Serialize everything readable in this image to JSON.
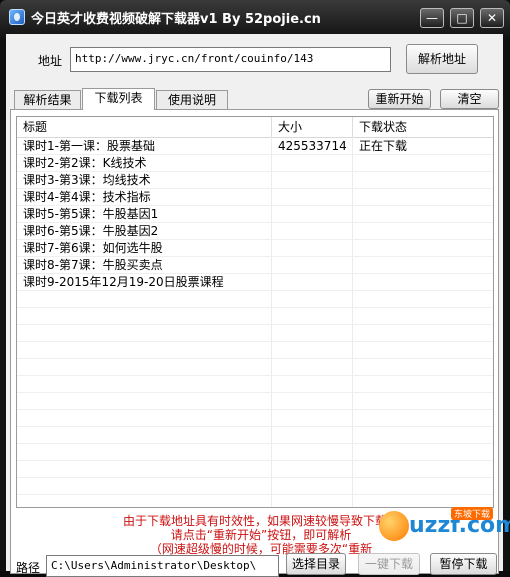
{
  "window": {
    "title": "今日英才收费视频破解下载器v1 By 52pojie.cn",
    "minimize_glyph": "—",
    "maximize_glyph": "□",
    "close_glyph": "✕"
  },
  "address": {
    "label": "地址",
    "value": "http://www.jryc.cn/front/couinfo/143",
    "parse_button": "解析地址"
  },
  "tabs": [
    {
      "label": "解析结果",
      "active": false
    },
    {
      "label": "下载列表",
      "active": true
    },
    {
      "label": "使用说明",
      "active": false
    }
  ],
  "toolbar": {
    "restart_button": "重新开始",
    "clear_button": "清空"
  },
  "table": {
    "columns": [
      "标题",
      "大小",
      "下载状态"
    ],
    "rows": [
      {
        "title": "课时1-第一课：股票基础",
        "size": "425533714",
        "status": "正在下载"
      },
      {
        "title": "课时2-第2课：K线技术",
        "size": "",
        "status": ""
      },
      {
        "title": "课时3-第3课：均线技术",
        "size": "",
        "status": ""
      },
      {
        "title": "课时4-第4课：技术指标",
        "size": "",
        "status": ""
      },
      {
        "title": "课时5-第5课：牛股基因1",
        "size": "",
        "status": ""
      },
      {
        "title": "课时6-第5课：牛股基因2",
        "size": "",
        "status": ""
      },
      {
        "title": "课时7-第6课：如何选牛股",
        "size": "",
        "status": ""
      },
      {
        "title": "课时8-第7课：牛股买卖点",
        "size": "",
        "status": ""
      },
      {
        "title": "课时9-2015年12月19-20日股票课程",
        "size": "",
        "status": ""
      }
    ]
  },
  "notice": {
    "line1": "由于下载地址具有时效性，如果网速较慢导致下载速",
    "line2": "请点击“重新开始”按钮，即可解析",
    "line3": "（网速超级慢的时候，可能需要多次“重新"
  },
  "path": {
    "label": "路径",
    "value": "C:\\Users\\Administrator\\Desktop\\",
    "select_button": "选择目录",
    "one_click_button": "一键下载",
    "pause_button": "暂停下载"
  },
  "watermark": {
    "brand": "uzzf.com",
    "badge": "东坡下载"
  },
  "colors": {
    "notice_text": "#cc1111",
    "title_bar": "#1a1a1a"
  }
}
